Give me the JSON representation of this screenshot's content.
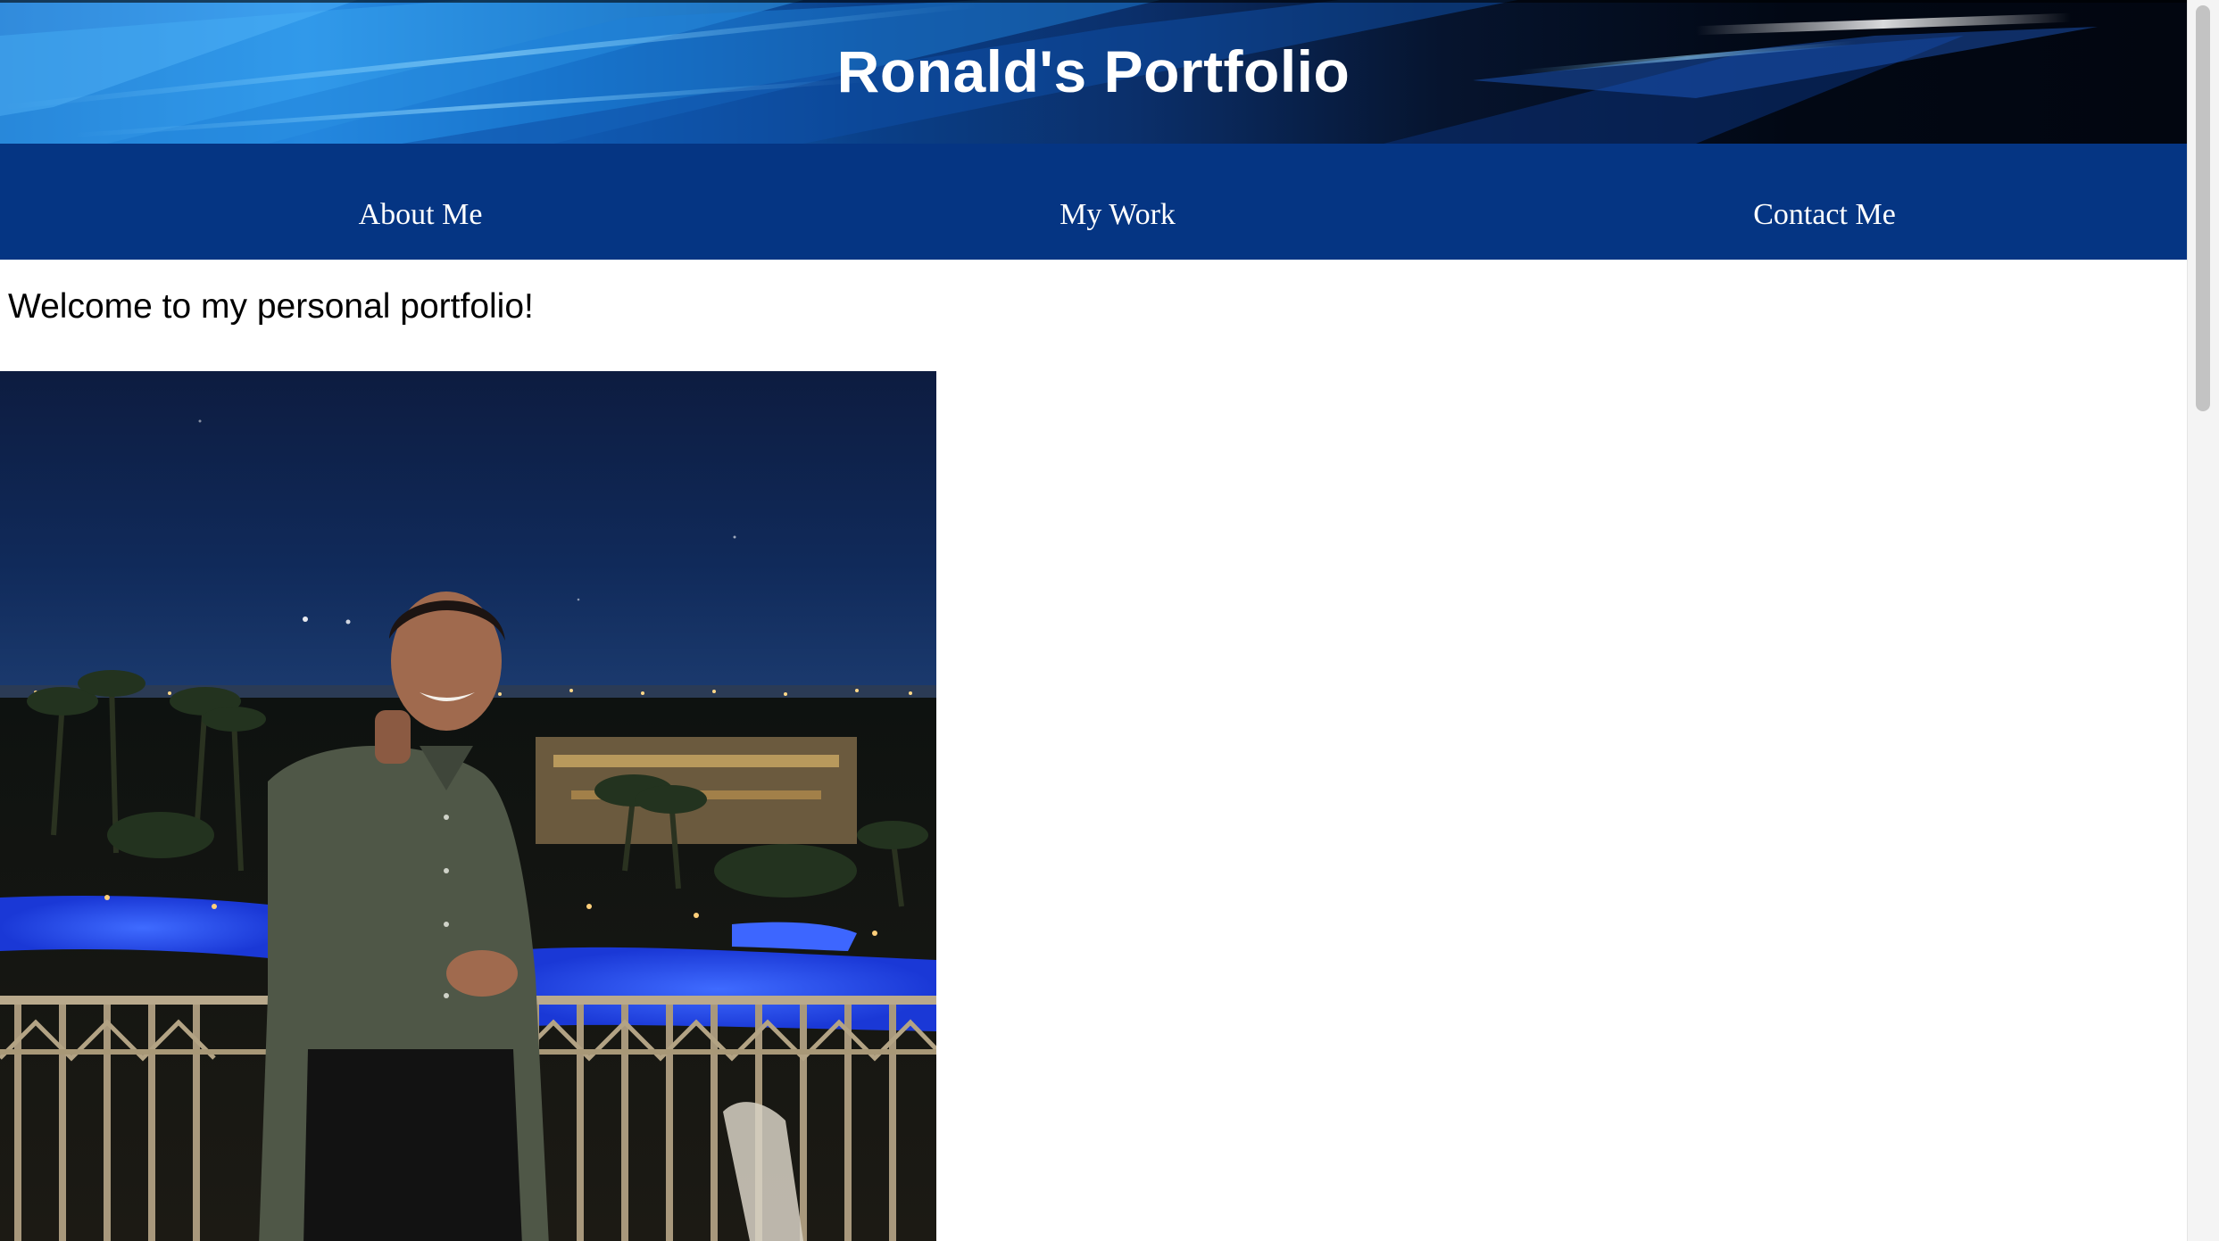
{
  "header": {
    "title": "Ronald's Portfolio"
  },
  "nav": {
    "items": [
      {
        "label": "About Me"
      },
      {
        "label": "My Work"
      },
      {
        "label": "Contact Me"
      }
    ]
  },
  "main": {
    "welcome_text": "Welcome to my personal portfolio!"
  },
  "colors": {
    "nav_background": "#053583",
    "banner_light_blue": "#2a8fe6",
    "banner_dark": "#020814",
    "text_on_dark": "#ffffff",
    "body_text": "#000000"
  }
}
